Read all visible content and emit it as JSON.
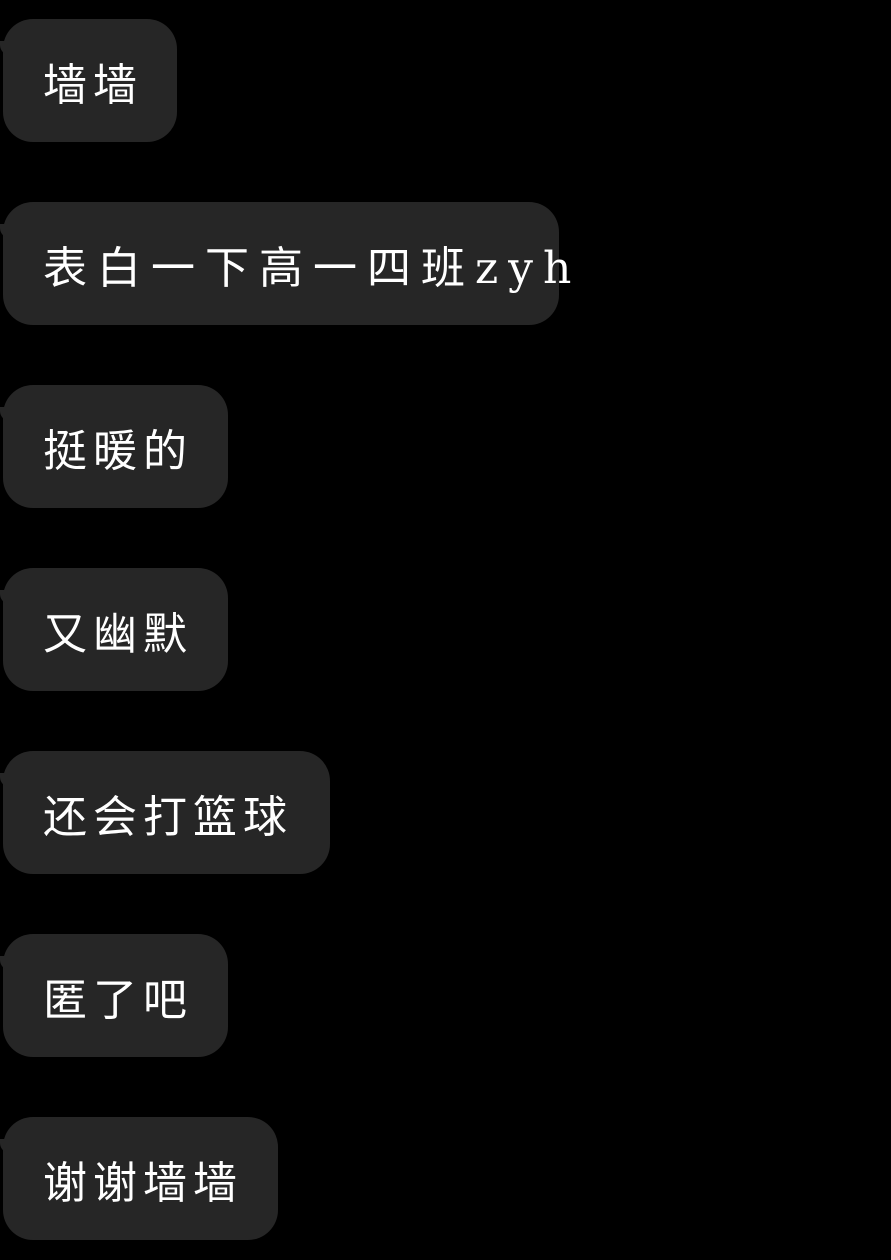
{
  "messages": [
    {
      "text": "墙墙"
    },
    {
      "text": "表白一下高一四班zyh"
    },
    {
      "text": "挺暖的"
    },
    {
      "text": "又幽默"
    },
    {
      "text": "还会打篮球"
    },
    {
      "text": "匿了吧"
    },
    {
      "text": "谢谢墙墙"
    }
  ],
  "colors": {
    "background": "#000000",
    "bubble": "#262626",
    "text": "#ffffff"
  }
}
